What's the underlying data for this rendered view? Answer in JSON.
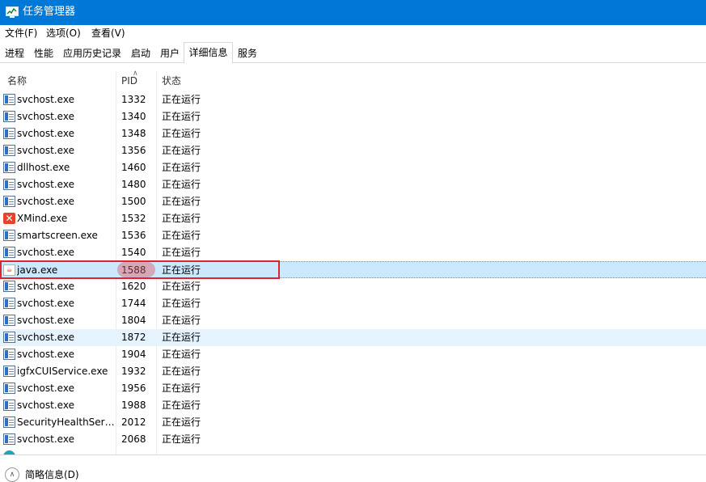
{
  "window": {
    "title": "任务管理器",
    "icon": "task-manager-icon"
  },
  "menu": [
    "文件(F)",
    "选项(O)",
    "查看(V)"
  ],
  "tabs": [
    "进程",
    "性能",
    "应用历史记录",
    "启动",
    "用户",
    "详细信息",
    "服务"
  ],
  "active_tab": "详细信息",
  "columns": {
    "name": "名称",
    "pid": "PID",
    "status": "状态",
    "sorted_by": "PID",
    "sort_direction": "ascending"
  },
  "rows": [
    {
      "name": "svchost.exe",
      "pid": "1332",
      "status": "正在运行",
      "icon": "service-host-icon"
    },
    {
      "name": "svchost.exe",
      "pid": "1340",
      "status": "正在运行",
      "icon": "service-host-icon"
    },
    {
      "name": "svchost.exe",
      "pid": "1348",
      "status": "正在运行",
      "icon": "service-host-icon"
    },
    {
      "name": "svchost.exe",
      "pid": "1356",
      "status": "正在运行",
      "icon": "service-host-icon"
    },
    {
      "name": "dllhost.exe",
      "pid": "1460",
      "status": "正在运行",
      "icon": "service-host-icon"
    },
    {
      "name": "svchost.exe",
      "pid": "1480",
      "status": "正在运行",
      "icon": "service-host-icon"
    },
    {
      "name": "svchost.exe",
      "pid": "1500",
      "status": "正在运行",
      "icon": "service-host-icon"
    },
    {
      "name": "XMind.exe",
      "pid": "1532",
      "status": "正在运行",
      "icon": "xmind-icon"
    },
    {
      "name": "smartscreen.exe",
      "pid": "1536",
      "status": "正在运行",
      "icon": "service-host-icon"
    },
    {
      "name": "svchost.exe",
      "pid": "1540",
      "status": "正在运行",
      "icon": "service-host-icon"
    },
    {
      "name": "java.exe",
      "pid": "1588",
      "status": "正在运行",
      "icon": "java-icon"
    },
    {
      "name": "svchost.exe",
      "pid": "1620",
      "status": "正在运行",
      "icon": "service-host-icon"
    },
    {
      "name": "svchost.exe",
      "pid": "1744",
      "status": "正在运行",
      "icon": "service-host-icon"
    },
    {
      "name": "svchost.exe",
      "pid": "1804",
      "status": "正在运行",
      "icon": "service-host-icon"
    },
    {
      "name": "svchost.exe",
      "pid": "1872",
      "status": "正在运行",
      "icon": "service-host-icon"
    },
    {
      "name": "svchost.exe",
      "pid": "1904",
      "status": "正在运行",
      "icon": "service-host-icon"
    },
    {
      "name": "igfxCUIService.exe",
      "pid": "1932",
      "status": "正在运行",
      "icon": "service-host-icon"
    },
    {
      "name": "svchost.exe",
      "pid": "1956",
      "status": "正在运行",
      "icon": "service-host-icon"
    },
    {
      "name": "svchost.exe",
      "pid": "1988",
      "status": "正在运行",
      "icon": "service-host-icon"
    },
    {
      "name": "SecurityHealthServi...",
      "pid": "2012",
      "status": "正在运行",
      "icon": "service-host-icon"
    },
    {
      "name": "svchost.exe",
      "pid": "2068",
      "status": "正在运行",
      "icon": "service-host-icon"
    },
    {
      "name": "",
      "pid": "",
      "status": "",
      "icon": "globe-icon"
    }
  ],
  "selected_row": "java.exe",
  "hovered_row_pid": "1872",
  "footer": {
    "label": "简略信息(D)"
  },
  "colors": {
    "titlebar": "#0078d7",
    "selection": "#cce8ff",
    "hover": "#e5f3ff",
    "annotation": "#e0242e"
  }
}
